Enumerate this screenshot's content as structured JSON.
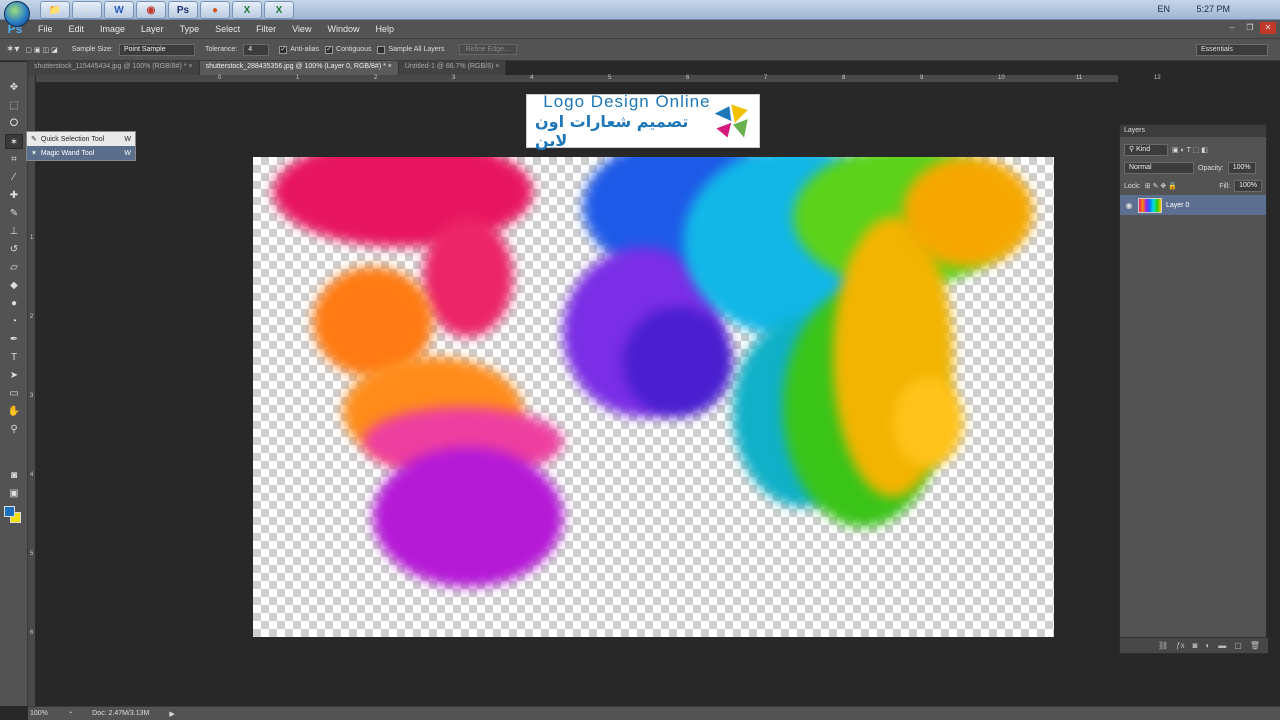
{
  "taskbar": {
    "apps": [
      "W",
      "C",
      "Ps",
      "F",
      "X",
      "X"
    ],
    "lang": "EN",
    "time": "5:27 PM"
  },
  "app": {
    "logo": "Ps",
    "menu": [
      "File",
      "Edit",
      "Image",
      "Layer",
      "Type",
      "Select",
      "Filter",
      "View",
      "Window",
      "Help"
    ]
  },
  "options": {
    "sample_size_label": "Sample Size:",
    "sample_size_value": "Point Sample",
    "tolerance_label": "Tolerance:",
    "tolerance_value": "4",
    "anti_alias": "Anti-alias",
    "contiguous": "Contiguous",
    "sample_all_layers": "Sample All Layers",
    "refine_edge": "Refine Edge...",
    "workspace": "Essentials"
  },
  "tabs": [
    {
      "label": "shutterstock_115445434.jpg @ 100% (RGB/8#) *",
      "close": "×"
    },
    {
      "label": "shutterstock_288435356.jpg @ 100% (Layer 0, RGB/8#) *",
      "close": "×"
    },
    {
      "label": "Untitled-1 @ 66.7% (RGB/8)",
      "close": "×"
    }
  ],
  "ruler": {
    "h": [
      "0",
      "1",
      "2",
      "3",
      "4",
      "5",
      "6",
      "7",
      "8",
      "9",
      "10",
      "11",
      "12"
    ],
    "v": [
      "1",
      "2",
      "3",
      "4",
      "5",
      "6"
    ]
  },
  "flyout": [
    {
      "label": "Quick Selection Tool",
      "key": "W"
    },
    {
      "label": "Magic Wand Tool",
      "key": "W"
    }
  ],
  "logo": {
    "en": "Logo Design Online",
    "ar": "تصميم شعارات اون لاين"
  },
  "layers": {
    "title": "Layers",
    "kind": "Kind",
    "blend": "Normal",
    "opacity_label": "Opacity:",
    "opacity": "100%",
    "lock_label": "Lock:",
    "fill_label": "Fill:",
    "fill": "100%",
    "layer_name": "Layer 0"
  },
  "status": {
    "zoom": "100%",
    "doc": "Doc: 2.47M/3.13M"
  }
}
